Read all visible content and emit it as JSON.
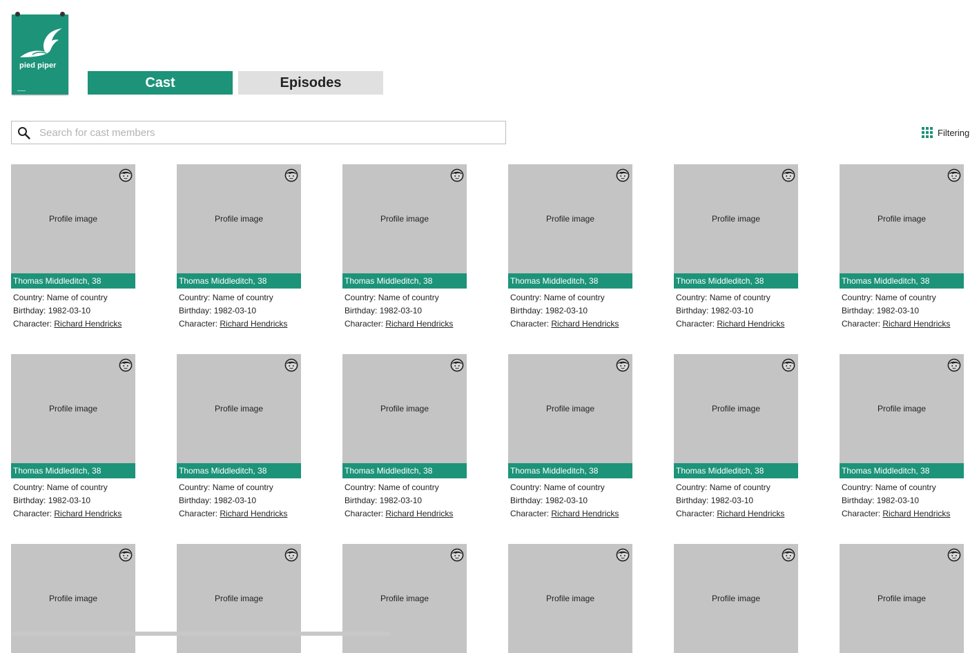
{
  "logo": {
    "text": "pied piper",
    "color": "#1d9379"
  },
  "tabs": [
    {
      "label": "Cast",
      "active": true
    },
    {
      "label": "Episodes",
      "active": false
    }
  ],
  "search": {
    "placeholder": "Search for cast members",
    "value": ""
  },
  "filter": {
    "label": "Filtering",
    "icon": "grid-icon"
  },
  "cast": [
    {
      "image_label": "Profile image",
      "name": "Thomas Middleditch, 38",
      "country_label": "Country: ",
      "country": "Name of country",
      "birthday_label": "Birthday: ",
      "birthday": "1982-03-10",
      "character_label": "Character: ",
      "character": "Richard Hendricks"
    },
    {
      "image_label": "Profile image",
      "name": "Thomas Middleditch, 38",
      "country_label": "Country: ",
      "country": "Name of country",
      "birthday_label": "Birthday: ",
      "birthday": "1982-03-10",
      "character_label": "Character: ",
      "character": "Richard Hendricks"
    },
    {
      "image_label": "Profile image",
      "name": "Thomas Middleditch, 38",
      "country_label": "Country: ",
      "country": "Name of country",
      "birthday_label": "Birthday: ",
      "birthday": "1982-03-10",
      "character_label": "Character: ",
      "character": "Richard Hendricks"
    },
    {
      "image_label": "Profile image",
      "name": "Thomas Middleditch, 38",
      "country_label": "Country: ",
      "country": "Name of country",
      "birthday_label": "Birthday: ",
      "birthday": "1982-03-10",
      "character_label": "Character: ",
      "character": "Richard Hendricks"
    },
    {
      "image_label": "Profile image",
      "name": "Thomas Middleditch, 38",
      "country_label": "Country: ",
      "country": "Name of country",
      "birthday_label": "Birthday: ",
      "birthday": "1982-03-10",
      "character_label": "Character: ",
      "character": "Richard Hendricks"
    },
    {
      "image_label": "Profile image",
      "name": "Thomas Middleditch, 38",
      "country_label": "Country: ",
      "country": "Name of country",
      "birthday_label": "Birthday: ",
      "birthday": "1982-03-10",
      "character_label": "Character: ",
      "character": "Richard Hendricks"
    },
    {
      "image_label": "Profile image",
      "name": "Thomas Middleditch, 38",
      "country_label": "Country: ",
      "country": "Name of country",
      "birthday_label": "Birthday: ",
      "birthday": "1982-03-10",
      "character_label": "Character: ",
      "character": "Richard Hendricks"
    },
    {
      "image_label": "Profile image",
      "name": "Thomas Middleditch, 38",
      "country_label": "Country: ",
      "country": "Name of country",
      "birthday_label": "Birthday: ",
      "birthday": "1982-03-10",
      "character_label": "Character: ",
      "character": "Richard Hendricks"
    },
    {
      "image_label": "Profile image",
      "name": "Thomas Middleditch, 38",
      "country_label": "Country: ",
      "country": "Name of country",
      "birthday_label": "Birthday: ",
      "birthday": "1982-03-10",
      "character_label": "Character: ",
      "character": "Richard Hendricks"
    },
    {
      "image_label": "Profile image",
      "name": "Thomas Middleditch, 38",
      "country_label": "Country: ",
      "country": "Name of country",
      "birthday_label": "Birthday: ",
      "birthday": "1982-03-10",
      "character_label": "Character: ",
      "character": "Richard Hendricks"
    },
    {
      "image_label": "Profile image",
      "name": "Thomas Middleditch, 38",
      "country_label": "Country: ",
      "country": "Name of country",
      "birthday_label": "Birthday: ",
      "birthday": "1982-03-10",
      "character_label": "Character: ",
      "character": "Richard Hendricks"
    },
    {
      "image_label": "Profile image",
      "name": "Thomas Middleditch, 38",
      "country_label": "Country: ",
      "country": "Name of country",
      "birthday_label": "Birthday: ",
      "birthday": "1982-03-10",
      "character_label": "Character: ",
      "character": "Richard Hendricks"
    },
    {
      "image_label": "Profile image"
    },
    {
      "image_label": "Profile image"
    },
    {
      "image_label": "Profile image"
    },
    {
      "image_label": "Profile image"
    },
    {
      "image_label": "Profile image"
    },
    {
      "image_label": "Profile image"
    }
  ],
  "colors": {
    "accent": "#1d9379",
    "placeholder_gray": "#c4c4c4",
    "tab_inactive": "#e0e0e0"
  }
}
